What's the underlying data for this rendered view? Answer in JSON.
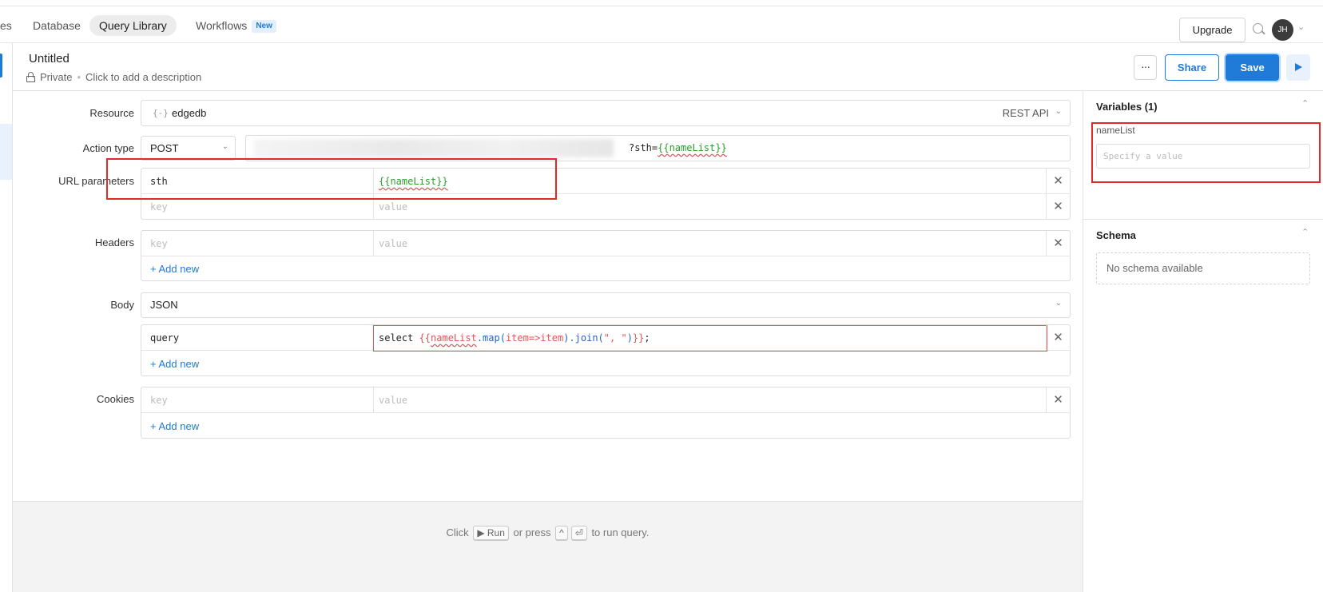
{
  "nav": {
    "items": [
      {
        "label": "es"
      },
      {
        "label": "Database"
      },
      {
        "label": "Query Library"
      },
      {
        "label": "Workflows"
      }
    ],
    "new_badge": "New",
    "upgrade_label": "Upgrade",
    "avatar_initials": "JH"
  },
  "query": {
    "title": "Untitled",
    "visibility": "Private",
    "description_placeholder": "Click to add a description",
    "more_label": "···",
    "share_label": "Share",
    "save_label": "Save"
  },
  "form": {
    "resource": {
      "label": "Resource",
      "icon": "{-}",
      "value": "edgedb",
      "type": "REST API"
    },
    "action": {
      "label": "Action type",
      "method": "POST",
      "url_suffix": "?sth=",
      "url_template": "{{nameList}}"
    },
    "url_params": {
      "label": "URL parameters",
      "rows": [
        {
          "key": "sth",
          "value": "{{nameList}}"
        },
        {
          "key": "",
          "value": ""
        }
      ]
    },
    "headers": {
      "label": "Headers",
      "rows": [
        {
          "key": "",
          "value": ""
        }
      ]
    },
    "body": {
      "label": "Body",
      "type": "JSON",
      "rows": [
        {
          "key": "query",
          "value_parts": [
            "select ",
            "{{",
            "nameList",
            ".map(",
            "item=>item",
            ").join(",
            "\", \"",
            ")",
            "}}",
            ";"
          ]
        }
      ]
    },
    "cookies": {
      "label": "Cookies",
      "rows": [
        {
          "key": "",
          "value": ""
        }
      ]
    },
    "key_placeholder": "key",
    "value_placeholder": "value",
    "add_new": "+ Add new",
    "remove": "✕"
  },
  "run_hint": {
    "pre": "Click",
    "run_key": "▶ Run",
    "mid": "or press",
    "key1": "^",
    "key2": "⏎",
    "post": "to run query."
  },
  "sidebar": {
    "variables_title": "Variables (1)",
    "variable_name": "nameList",
    "variable_placeholder": "Specify a value",
    "schema_title": "Schema",
    "schema_empty": "No schema available"
  },
  "colors": {
    "accent": "#1f7ad8",
    "annotation": "#e22a2a",
    "template": "#2a9d2a"
  }
}
